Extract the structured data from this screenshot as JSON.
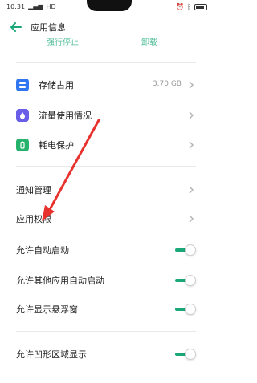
{
  "status_bar": {
    "time": "10:31",
    "network": "HD",
    "battery_color": "#333333"
  },
  "header": {
    "title": "应用信息",
    "back_icon": "arrow-left-icon"
  },
  "partial_actions": [
    "强行停止",
    "卸载"
  ],
  "storage_section": [
    {
      "label": "存储占用",
      "value": "3.70 GB",
      "icon": "storage-icon",
      "color": "#2f76f0"
    },
    {
      "label": "流量使用情况",
      "value": "",
      "icon": "data-usage-icon",
      "color": "#6a5ee8"
    },
    {
      "label": "耗电保护",
      "value": "",
      "icon": "battery-protect-icon",
      "color": "#25b26b"
    }
  ],
  "nav_section": [
    {
      "label": "通知管理"
    },
    {
      "label": "应用权限"
    }
  ],
  "toggles": [
    {
      "label": "允许自动启动",
      "on": true
    },
    {
      "label": "允许其他应用自动启动",
      "on": true
    },
    {
      "label": "允许显示悬浮窗",
      "on": true
    }
  ],
  "bottom_toggle": {
    "label": "允许凹形区域显示",
    "on": true
  },
  "colors": {
    "accent": "#1aa879",
    "annotation_arrow": "#e8322e"
  }
}
